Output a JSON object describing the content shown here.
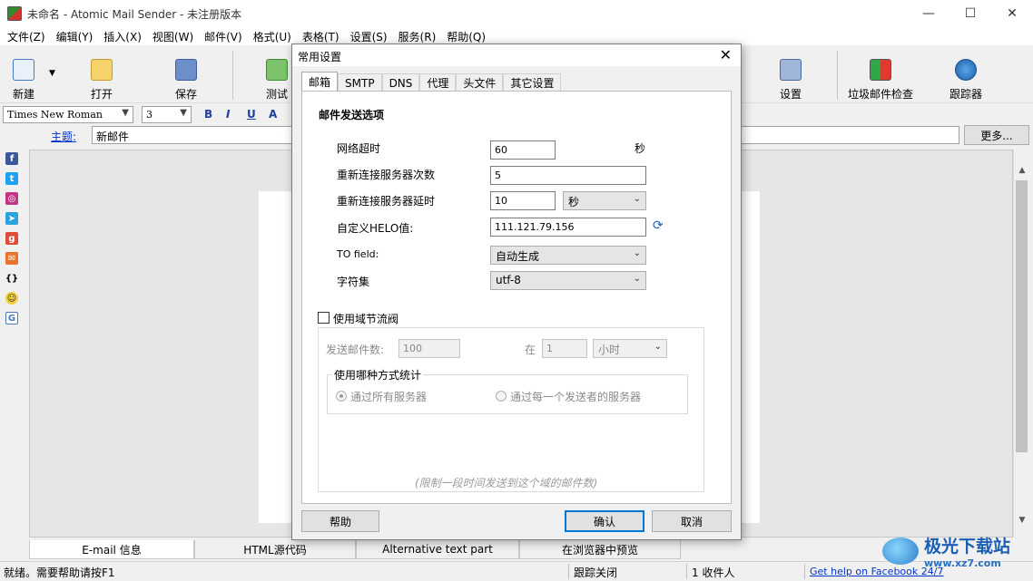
{
  "window": {
    "title": "未命名 - Atomic Mail Sender - 未注册版本",
    "minimize": "—",
    "maximize": "☐",
    "close": "✕"
  },
  "menu": [
    "文件(Z)",
    "编辑(Y)",
    "插入(X)",
    "视图(W)",
    "邮件(V)",
    "格式(U)",
    "表格(T)",
    "设置(S)",
    "服务(R)",
    "帮助(Q)"
  ],
  "toolbar": {
    "new": "新建",
    "open": "打开",
    "save": "保存",
    "test": "测试",
    "settings": "设置",
    "spam_check": "垃圾邮件检查",
    "tracker": "跟踪器"
  },
  "format": {
    "font": "Times New Roman",
    "size": "3",
    "bold": "B",
    "italic": "I",
    "underline": "U",
    "color": "A"
  },
  "subject": {
    "label": "主题:",
    "value": "新邮件",
    "more": "更多..."
  },
  "bottom_tabs": [
    "E-mail 信息",
    "HTML源代码",
    "Alternative text part",
    "在浏览器中预览"
  ],
  "status": {
    "ready": "就绪。需要帮助请按F1",
    "tracking": "跟踪关闭",
    "recipients": "1 收件人",
    "facebook": "Get help on Facebook 24/7"
  },
  "watermark": {
    "name": "极光下载站",
    "url": "www.xz7.com"
  },
  "dialog": {
    "title": "常用设置",
    "close": "✕",
    "tabs": [
      "邮箱",
      "SMTP",
      "DNS",
      "代理",
      "头文件",
      "其它设置"
    ],
    "section_title": "邮件发送选项",
    "network_timeout": {
      "label": "网络超时",
      "value": "60",
      "unit": "秒"
    },
    "reconnect_count": {
      "label": "重新连接服务器次数",
      "value": "5"
    },
    "reconnect_delay": {
      "label": "重新连接服务器延时",
      "value": "10",
      "unit": "秒"
    },
    "helo": {
      "label": "自定义HELO值:",
      "value": "111.121.79.156"
    },
    "to_field": {
      "label": "TO field:",
      "value": "自动生成"
    },
    "charset": {
      "label": "字符集",
      "value": "utf-8"
    },
    "domain_throttle": {
      "label": "使用域节流阀",
      "send_count_label": "发送邮件数:",
      "send_count": "100",
      "in_label": "在",
      "in_value": "1",
      "period": "小时",
      "group_caption": "使用哪种方式统计",
      "option_all": "通过所有服务器",
      "option_each": "通过每一个发送者的服务器",
      "note": "(限制一段时间发送到这个域的邮件数)"
    },
    "help": "帮助",
    "ok": "确认",
    "cancel": "取消"
  }
}
